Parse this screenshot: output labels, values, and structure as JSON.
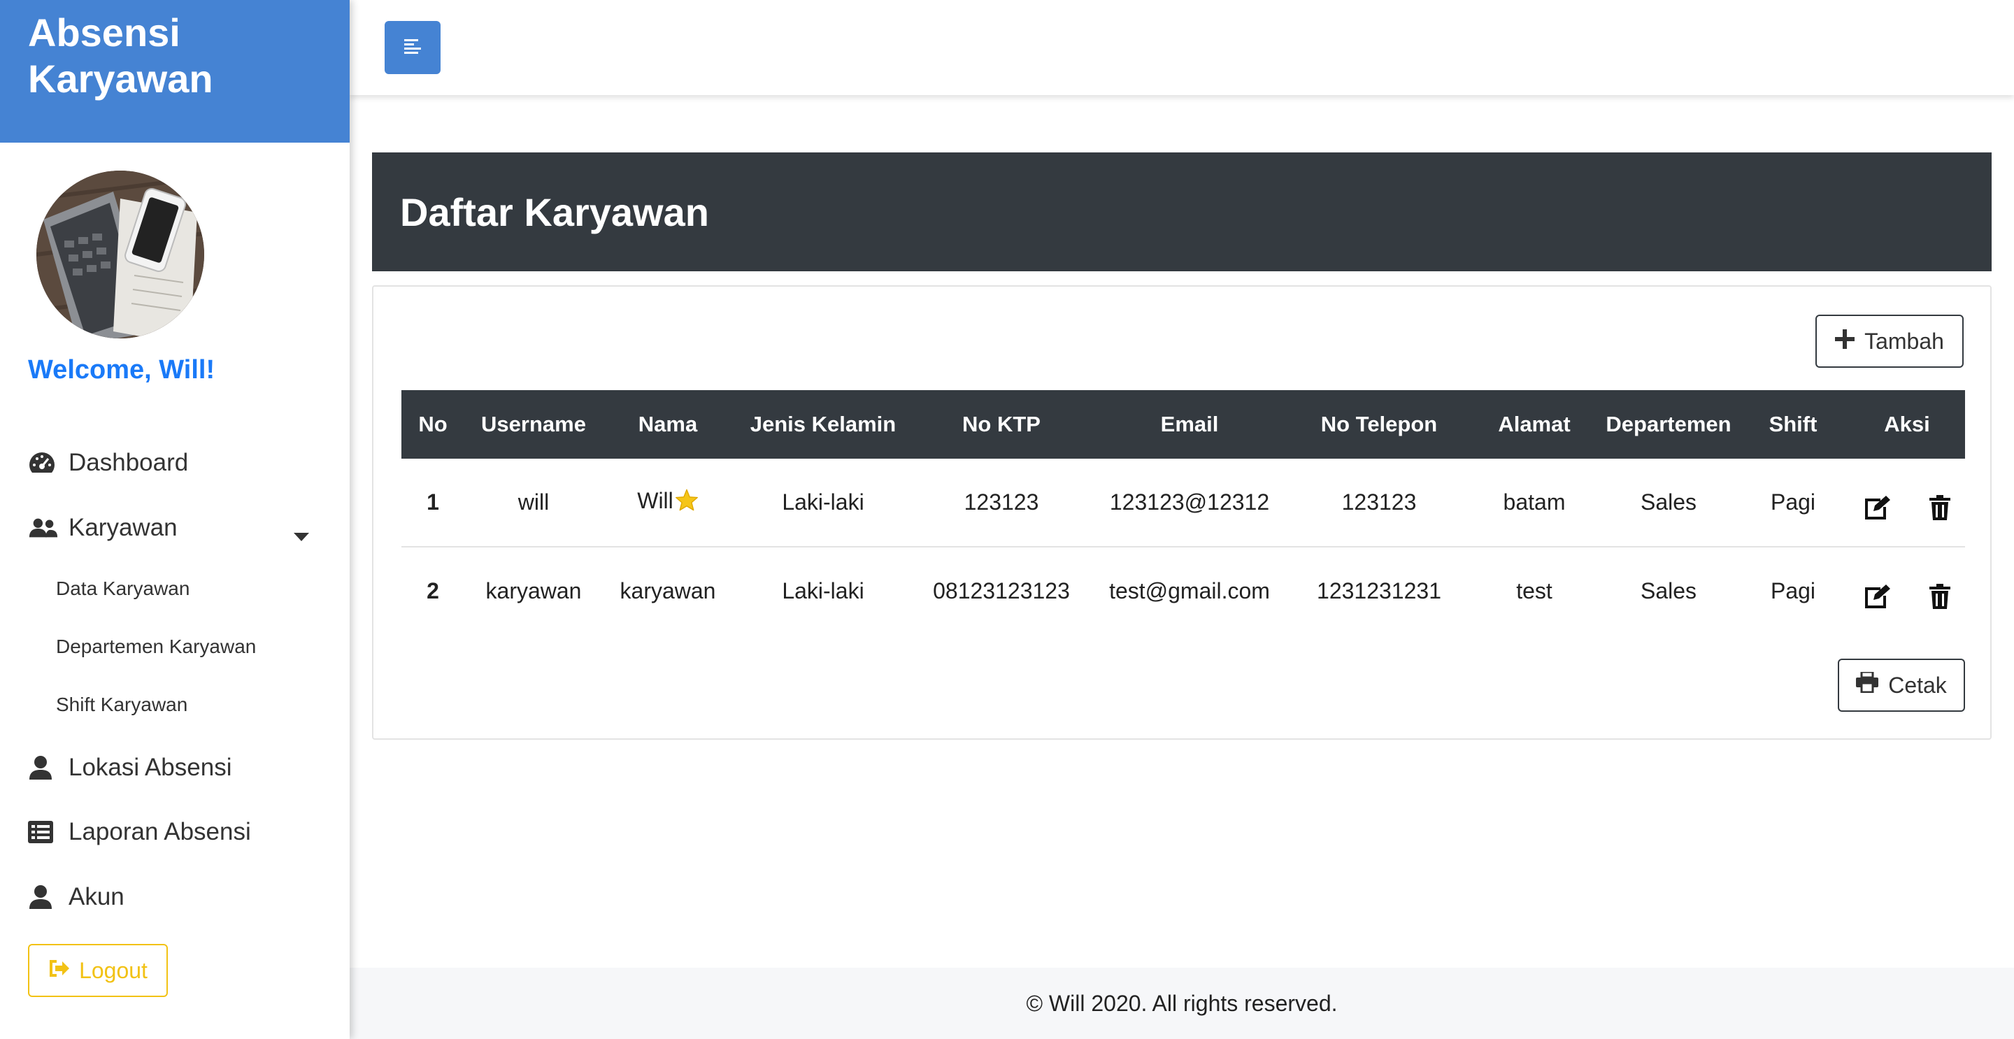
{
  "app": {
    "title": "Absensi Karyawan"
  },
  "sidebar": {
    "welcome": "Welcome, Will!",
    "items": [
      {
        "label": "Dashboard",
        "icon": "tachometer-icon"
      },
      {
        "label": "Karyawan",
        "icon": "users-icon",
        "expanded": true,
        "children": [
          {
            "label": "Data Karyawan"
          },
          {
            "label": "Departemen Karyawan"
          },
          {
            "label": "Shift Karyawan"
          }
        ]
      },
      {
        "label": "Lokasi Absensi",
        "icon": "user-icon"
      },
      {
        "label": "Laporan Absensi",
        "icon": "list-icon"
      },
      {
        "label": "Akun",
        "icon": "user-icon"
      }
    ],
    "logout_label": "Logout"
  },
  "colors": {
    "brand": "#4583d3",
    "dark": "#343a40",
    "welcome": "#1a7af8",
    "logout": "#f2c215"
  },
  "page": {
    "title": "Daftar Karyawan",
    "add_label": "Tambah",
    "print_label": "Cetak"
  },
  "table": {
    "headers": [
      "No",
      "Username",
      "Nama",
      "Jenis Kelamin",
      "No KTP",
      "Email",
      "No Telepon",
      "Alamat",
      "Departemen",
      "Shift",
      "Aksi"
    ],
    "rows": [
      {
        "no": "1",
        "username": "will",
        "nama": "Will",
        "nama_badge": "star-icon",
        "jenis_kelamin": "Laki-laki",
        "no_ktp": "123123",
        "email": "123123@12312",
        "no_telepon": "123123",
        "alamat": "batam",
        "departemen": "Sales",
        "shift": "Pagi"
      },
      {
        "no": "2",
        "username": "karyawan",
        "nama": "karyawan",
        "jenis_kelamin": "Laki-laki",
        "no_ktp": "08123123123",
        "email": "test@gmail.com",
        "no_telepon": "1231231231",
        "alamat": "test",
        "departemen": "Sales",
        "shift": "Pagi"
      }
    ]
  },
  "footer": {
    "text": "© Will 2020. All rights reserved."
  }
}
